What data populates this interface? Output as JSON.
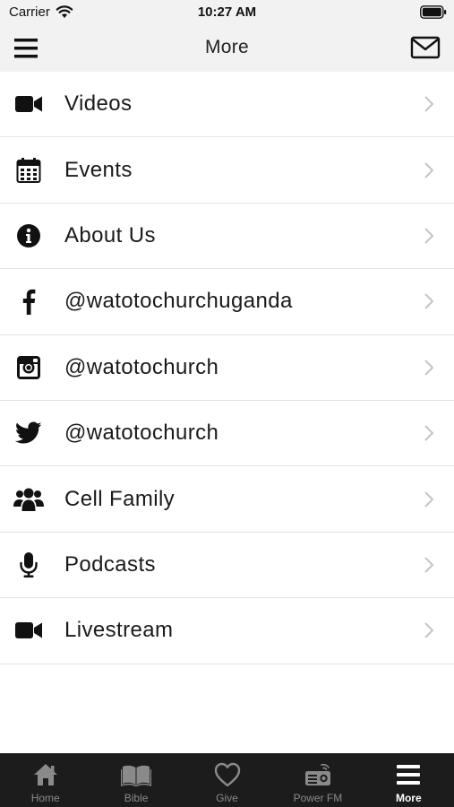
{
  "status_bar": {
    "carrier": "Carrier",
    "time": "10:27 AM"
  },
  "nav": {
    "title": "More"
  },
  "items": [
    {
      "label": "Videos",
      "icon": "video-camera-icon"
    },
    {
      "label": "Events",
      "icon": "calendar-icon"
    },
    {
      "label": "About Us",
      "icon": "info-icon"
    },
    {
      "label": "@watotochurchuganda",
      "icon": "facebook-icon"
    },
    {
      "label": "@watotochurch",
      "icon": "instagram-icon"
    },
    {
      "label": "@watotochurch",
      "icon": "twitter-icon"
    },
    {
      "label": "Cell Family",
      "icon": "users-icon"
    },
    {
      "label": "Podcasts",
      "icon": "microphone-icon"
    },
    {
      "label": "Livestream",
      "icon": "video-camera-icon"
    }
  ],
  "tabs": [
    {
      "label": "Home",
      "icon": "home-icon",
      "active": false
    },
    {
      "label": "Bible",
      "icon": "bible-icon",
      "active": false
    },
    {
      "label": "Give",
      "icon": "heart-icon",
      "active": false
    },
    {
      "label": "Power FM",
      "icon": "radio-icon",
      "active": false
    },
    {
      "label": "More",
      "icon": "menu-icon",
      "active": true
    }
  ],
  "colors": {
    "bar_bg": "#f2f2f2",
    "tab_bg": "#1c1c1c",
    "tab_inactive": "#8a8a8a",
    "tab_active": "#ffffff",
    "chevron": "#c4c4c4"
  }
}
